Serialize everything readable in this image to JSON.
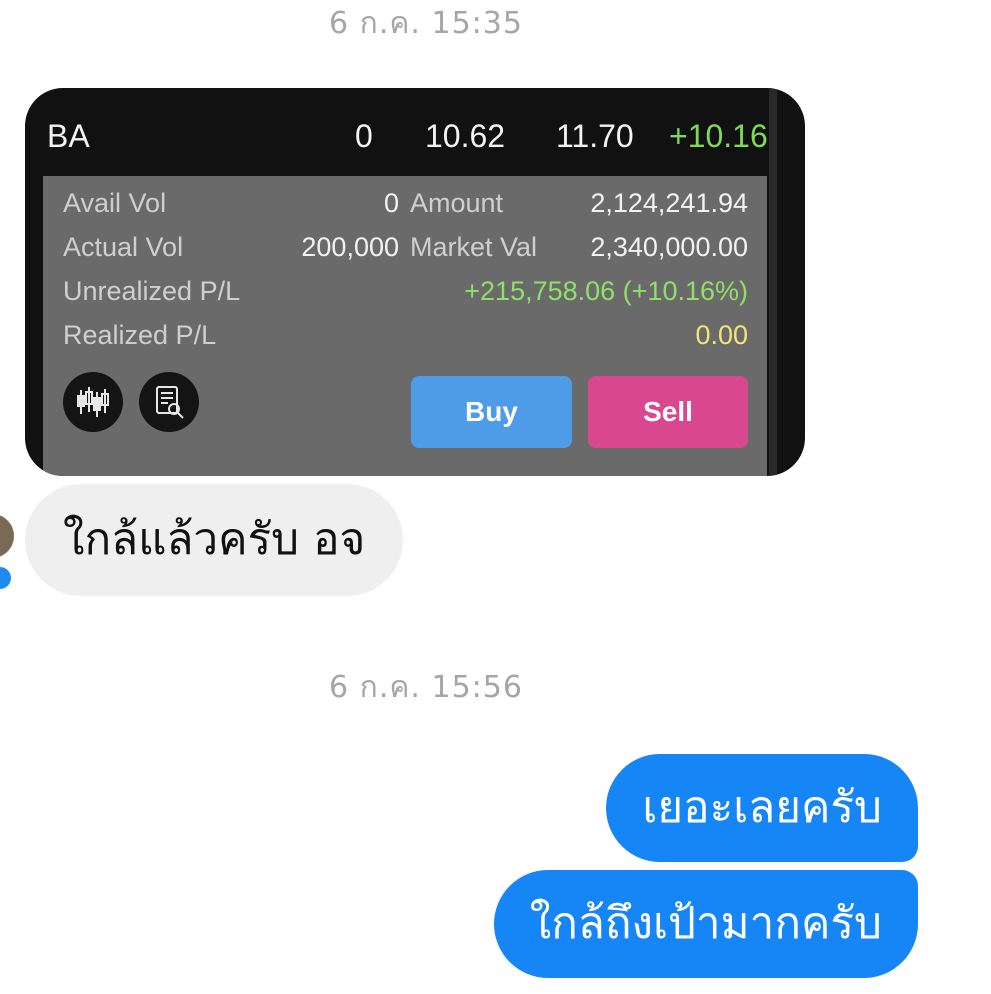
{
  "conversation": {
    "timestamps": [
      "6 ก.ค. 15:35",
      "6 ก.ค. 15:56"
    ],
    "incoming_messages": [
      {
        "text": "ใกล้แล้วครับ อจ"
      }
    ],
    "outgoing_messages": [
      {
        "text": "เยอะเลยครับ"
      },
      {
        "text": "ใกล้ถึงเป้ามากครับ"
      }
    ]
  },
  "trade_card": {
    "symbol": "BA",
    "available_volume_header": "0",
    "average_cost": "10.62",
    "last_price": "11.70",
    "change_percent": "+10.16",
    "rows": [
      {
        "label_left": "Avail Vol",
        "value_mid": "0",
        "label_mid": "Amount",
        "value_right": "2,124,241.94"
      },
      {
        "label_left": "Actual Vol",
        "value_mid": "200,000",
        "label_mid": "Market Val",
        "value_right": "2,340,000.00"
      },
      {
        "label_left": "Unrealized P/L",
        "value_right": "+215,758.06 (+10.16%)"
      },
      {
        "label_left": "Realized P/L",
        "value_right": "0.00"
      }
    ],
    "icons": [
      "candlestick-chart-icon",
      "document-search-icon"
    ],
    "buy_label": "Buy",
    "sell_label": "Sell"
  },
  "colors": {
    "incoming_bubble": "#efefef",
    "outgoing_bubble": "#1686f6",
    "buy_button": "#4e9be8",
    "sell_button": "#d9478f",
    "positive": "#8fe06a",
    "neutral_value": "#f4e27a"
  }
}
